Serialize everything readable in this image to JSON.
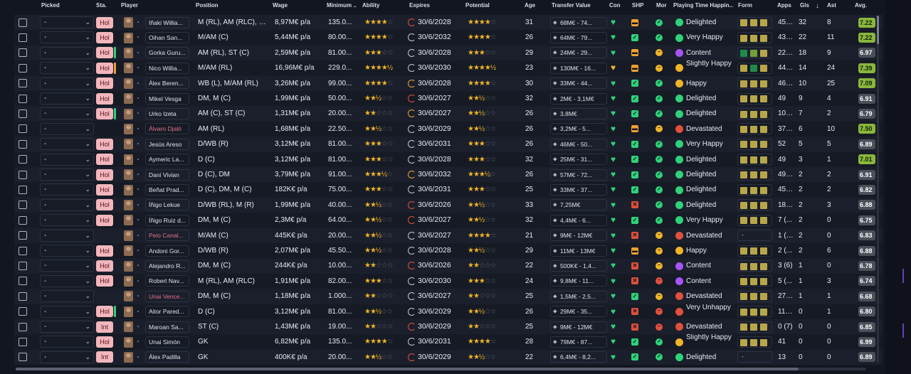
{
  "header": {
    "picked": "Picked",
    "sta": "Sta.",
    "player": "Player",
    "position": "Position",
    "wage": "Wage",
    "minimum": "Minimum ...",
    "ability": "Ability",
    "expires": "Expires",
    "potential": "Potential",
    "age": "Age",
    "transfer_value": "Transfer Value",
    "con": "Con",
    "shp": "SHP",
    "mor": "Mor",
    "playing_time": "Playing Time Happin...",
    "form": "Form",
    "apps": "Apps",
    "gls": "Gls",
    "sort_icon": "↓",
    "ast": "Ast",
    "avg": "Avg."
  },
  "colors": {
    "form_olive": "#b8a64a",
    "form_green": "#6fa03a",
    "form_dark_green": "#1f8a4a",
    "shp_orange": "#f0a030",
    "shp_green": "#2fd27a",
    "shp_red": "#e0503c",
    "hap_green": "#2fd27a",
    "hap_purple": "#a855f7",
    "hap_yellow": "#f0b429",
    "hap_red": "#e0503c",
    "con_green": "#2fd27a",
    "con_yellow": "#f0b429",
    "loan_name": "#e0748a",
    "rating_green": "#8ab63c"
  },
  "rows": [
    {
      "picked": "-",
      "sta": "Hol",
      "stabar": "none",
      "name": "Iñaki Willia...",
      "loan": false,
      "position": "M (RL), AM (RLC), S...",
      "wage": "8,97M€ p/a",
      "min": "135.0...",
      "ability": "★★★★",
      "ability_e": "☆",
      "expires": "30/6/2028",
      "exp": "red",
      "potential": "★★★★",
      "potential_e": "☆",
      "age": "31",
      "tv": "68M€ - 74...",
      "con": "💚",
      "shp": "orange",
      "mor": "green",
      "hap": "Delighted",
      "hapc": "green",
      "form": [
        "olive",
        "olive",
        "olive"
      ],
      "apps": "45 ...",
      "gls": "32",
      "ast": "8",
      "avg": "7.22",
      "avgc": "green"
    },
    {
      "picked": "-",
      "sta": "Hol",
      "stabar": "none",
      "name": "Oihan San...",
      "loan": false,
      "position": "M/AM (C)",
      "wage": "5,44M€ p/a",
      "min": "80.00...",
      "ability": "★★★★",
      "ability_e": "☆",
      "expires": "30/6/2032",
      "exp": "grey",
      "potential": "★★★★",
      "potential_e": "☆",
      "age": "26",
      "tv": "64M€ - 79...",
      "con": "💚",
      "shp": "green",
      "mor": "green",
      "hap": "Very Happy",
      "hapc": "green",
      "form": [
        "olive",
        "olive",
        "olive"
      ],
      "apps": "43 ...",
      "gls": "22",
      "ast": "11",
      "avg": "7.22",
      "avgc": "green"
    },
    {
      "picked": "-",
      "sta": "Hol",
      "stabar": "green",
      "name": "Gorka Guru...",
      "loan": false,
      "position": "AM (RL), ST (C)",
      "wage": "2,59M€ p/a",
      "min": "81.00...",
      "ability": "★★★",
      "ability_e": "☆☆",
      "expires": "30/6/2028",
      "exp": "grey",
      "potential": "★★★",
      "potential_e": "☆☆",
      "age": "29",
      "tv": "24M€ - 29...",
      "con": "💚",
      "shp": "orange",
      "mor": "yellow",
      "hap": "Content",
      "hapc": "purple",
      "form": [
        "dgreen",
        "green",
        "olive"
      ],
      "apps": "22 ...",
      "gls": "18",
      "ast": "9",
      "avg": "6.97",
      "avgc": "grey"
    },
    {
      "picked": "-",
      "sta": "Hol",
      "stabar": "orange",
      "name": "Nico Willia...",
      "loan": false,
      "position": "M/AM (RL)",
      "wage": "16,96M€ p/a",
      "min": "229.0...",
      "ability": "★★★★½",
      "ability_e": "",
      "expires": "30/6/2030",
      "exp": "grey",
      "potential": "★★★★½",
      "potential_e": "",
      "age": "23",
      "tv": "130M€ - 16...",
      "con": "💛",
      "shp": "orange",
      "mor": "yellow",
      "hap": "Slightly Happy",
      "hapc": "yellow",
      "form": [
        "olive",
        "dgreen",
        "olive"
      ],
      "apps": "44 ...",
      "gls": "14",
      "ast": "24",
      "avg": "7.39",
      "avgc": "green"
    },
    {
      "picked": "-",
      "sta": "Hol",
      "stabar": "none",
      "name": "Álex Beren...",
      "loan": false,
      "position": "WB (L), M/AM (RL)",
      "wage": "3,26M€ p/a",
      "min": "99.00...",
      "ability": "★★★★",
      "ability_e": "☆",
      "expires": "30/6/2028",
      "exp": "orange",
      "potential": "★★★★",
      "potential_e": "☆",
      "age": "30",
      "tv": "33M€ - 44...",
      "con": "💚",
      "shp": "green",
      "mor": "green",
      "hap": "Happy",
      "hapc": "yellow",
      "form": [
        "olive",
        "olive",
        "olive"
      ],
      "apps": "46 ...",
      "gls": "10",
      "ast": "25",
      "avg": "7.09",
      "avgc": "green"
    },
    {
      "picked": "-",
      "sta": "Hol",
      "stabar": "none",
      "name": "Mikel Vesga",
      "loan": false,
      "position": "DM, M (C)",
      "wage": "1,99M€ p/a",
      "min": "50.00...",
      "ability": "★★½",
      "ability_e": "☆☆",
      "expires": "30/6/2027",
      "exp": "red",
      "potential": "★★½",
      "potential_e": "☆☆",
      "age": "32",
      "tv": "2M€ - 3,1M€",
      "con": "💚",
      "shp": "green",
      "mor": "green",
      "hap": "Delighted",
      "hapc": "green",
      "form": [
        "olive",
        "olive",
        "olive"
      ],
      "apps": "49",
      "gls": "9",
      "ast": "4",
      "avg": "6.91",
      "avgc": "grey"
    },
    {
      "picked": "-",
      "sta": "Hol",
      "stabar": "green",
      "name": "Urko Izeta",
      "loan": false,
      "position": "AM (C), ST (C)",
      "wage": "1,31M€ p/a",
      "min": "20.00...",
      "ability": "★★",
      "ability_e": "☆☆☆",
      "expires": "30/6/2027",
      "exp": "orange",
      "potential": "★★½",
      "potential_e": "☆☆",
      "age": "26",
      "tv": "3,8M€",
      "con": "💚",
      "shp": "green",
      "mor": "green",
      "hap": "Delighted",
      "hapc": "green",
      "form": [
        "olive",
        "olive",
        "olive"
      ],
      "apps": "10 (...",
      "gls": "7",
      "ast": "2",
      "avg": "6.79",
      "avgc": "grey"
    },
    {
      "picked": "-",
      "sta": "",
      "stabar": "none",
      "name": "Álvaro Djaló",
      "loan": true,
      "position": "AM (RL)",
      "wage": "1,68M€ p/a",
      "min": "22.50...",
      "ability": "★★½",
      "ability_e": "☆☆",
      "expires": "30/6/2029",
      "exp": "grey",
      "potential": "★★½",
      "potential_e": "☆☆",
      "age": "26",
      "tv": "3,2M€ - 5...",
      "con": "💚",
      "shp": "orange",
      "mor": "yellow",
      "hap": "Devastated",
      "hapc": "red",
      "form": [
        "olive",
        "olive",
        "olive"
      ],
      "apps": "37 ...",
      "gls": "6",
      "ast": "10",
      "avg": "7.50",
      "avgc": "green"
    },
    {
      "picked": "-",
      "sta": "Hol",
      "stabar": "none",
      "name": "Jesús Areso",
      "loan": false,
      "position": "D/WB (R)",
      "wage": "3,12M€ p/a",
      "min": "81.00...",
      "ability": "★★★",
      "ability_e": "☆☆",
      "expires": "30/6/2031",
      "exp": "grey",
      "potential": "★★★",
      "potential_e": "☆☆",
      "age": "26",
      "tv": "46M€ - 50...",
      "con": "💚",
      "shp": "green",
      "mor": "green",
      "hap": "Very Happy",
      "hapc": "green",
      "form": [
        "olive",
        "olive",
        "olive"
      ],
      "apps": "52",
      "gls": "5",
      "ast": "5",
      "avg": "6.89",
      "avgc": "grey"
    },
    {
      "picked": "-",
      "sta": "Hol",
      "stabar": "none",
      "name": "Aymeric La...",
      "loan": false,
      "position": "D (C)",
      "wage": "3,12M€ p/a",
      "min": "81.00...",
      "ability": "★★★",
      "ability_e": "☆☆",
      "expires": "30/6/2028",
      "exp": "grey",
      "potential": "★★★",
      "potential_e": "☆☆",
      "age": "32",
      "tv": "25M€ - 31...",
      "con": "💚",
      "shp": "green",
      "mor": "green",
      "hap": "Delighted",
      "hapc": "green",
      "form": [
        "olive",
        "olive",
        "olive"
      ],
      "apps": "49",
      "gls": "3",
      "ast": "1",
      "avg": "7.01",
      "avgc": "green"
    },
    {
      "picked": "-",
      "sta": "Hol",
      "stabar": "none",
      "name": "Dani Vivian",
      "loan": false,
      "position": "D (C), DM",
      "wage": "3,79M€ p/a",
      "min": "91.00...",
      "ability": "★★★½",
      "ability_e": "☆",
      "expires": "30/6/2032",
      "exp": "orange",
      "potential": "★★★½",
      "potential_e": "☆",
      "age": "26",
      "tv": "57M€ - 72...",
      "con": "💚",
      "shp": "green",
      "mor": "green",
      "hap": "Delighted",
      "hapc": "green",
      "form": [
        "olive",
        "olive",
        "olive"
      ],
      "apps": "49 ...",
      "gls": "2",
      "ast": "2",
      "avg": "6.91",
      "avgc": "grey"
    },
    {
      "picked": "-",
      "sta": "Hol",
      "stabar": "none",
      "name": "Beñat Prad...",
      "loan": false,
      "position": "D (C), DM, M (C)",
      "wage": "182K€ p/a",
      "min": "75.00...",
      "ability": "★★★",
      "ability_e": "☆☆",
      "expires": "30/6/2031",
      "exp": "grey",
      "potential": "★★★",
      "potential_e": "☆☆",
      "age": "25",
      "tv": "33M€ - 37...",
      "con": "💚",
      "shp": "green",
      "mor": "green",
      "hap": "Delighted",
      "hapc": "green",
      "form": [
        "olive",
        "olive",
        "olive"
      ],
      "apps": "45 ...",
      "gls": "2",
      "ast": "2",
      "avg": "6.82",
      "avgc": "grey"
    },
    {
      "picked": "-",
      "sta": "Hol",
      "stabar": "none",
      "name": "Íñigo Lekue",
      "loan": false,
      "position": "D/WB (RL), M (R)",
      "wage": "1,99M€ p/a",
      "min": "40.00...",
      "ability": "★★½",
      "ability_e": "☆☆",
      "expires": "30/6/2026",
      "exp": "red",
      "potential": "★★½",
      "potential_e": "☆☆",
      "age": "33",
      "tv": "7,25M€",
      "con": "💚",
      "shp": "red",
      "mor": "green",
      "hap": "Delighted",
      "hapc": "green",
      "form": [
        "olive",
        "olive",
        "olive"
      ],
      "apps": "18 ...",
      "gls": "2",
      "ast": "3",
      "avg": "6.88",
      "avgc": "grey"
    },
    {
      "picked": "-",
      "sta": "Hol",
      "stabar": "none",
      "name": "Íñigo Ruiz d...",
      "loan": false,
      "position": "DM, M (C)",
      "wage": "2,3M€ p/a",
      "min": "64.00...",
      "ability": "★★½",
      "ability_e": "☆☆",
      "expires": "30/6/2027",
      "exp": "red",
      "potential": "★★½",
      "potential_e": "☆☆",
      "age": "32",
      "tv": "4,4M€ - 6...",
      "con": "💚",
      "shp": "green",
      "mor": "green",
      "hap": "Very Happy",
      "hapc": "green",
      "form": [
        "olive",
        "olive",
        "olive"
      ],
      "apps": "7 (...",
      "gls": "2",
      "ast": "0",
      "avg": "6.75",
      "avgc": "grey"
    },
    {
      "picked": "-",
      "sta": "",
      "stabar": "none",
      "name": "Peio Canal...",
      "loan": true,
      "position": "M/AM (C)",
      "wage": "445K€ p/a",
      "min": "20.00...",
      "ability": "★★½",
      "ability_e": "☆☆",
      "expires": "30/6/2027",
      "exp": "grey",
      "potential": "★★★★",
      "potential_e": "☆",
      "age": "21",
      "tv": "9M€ - 12M€",
      "con": "💚",
      "shp": "red",
      "mor": "yellow",
      "hap": "Devastated",
      "hapc": "red",
      "form": [],
      "apps": "1 (17)",
      "gls": "2",
      "ast": "0",
      "avg": "6.83",
      "avgc": "grey"
    },
    {
      "picked": "-",
      "sta": "Hol",
      "stabar": "none",
      "name": "Andoni Gor...",
      "loan": false,
      "position": "D/WB (R)",
      "wage": "2,07M€ p/a",
      "min": "45.50...",
      "ability": "★★½",
      "ability_e": "☆☆",
      "expires": "30/6/2028",
      "exp": "grey",
      "potential": "★★½",
      "potential_e": "☆☆",
      "age": "29",
      "tv": "11M€ - 13M€",
      "con": "💚",
      "shp": "orange",
      "mor": "yellow",
      "hap": "Happy",
      "hapc": "yellow",
      "form": [
        "olive",
        "olive",
        "olive"
      ],
      "apps": "2 (...",
      "gls": "2",
      "ast": "6",
      "avg": "6.88",
      "avgc": "grey"
    },
    {
      "picked": "-",
      "sta": "Hol",
      "stabar": "none",
      "name": "Alejandro R...",
      "loan": false,
      "position": "DM, M (C)",
      "wage": "244K€ p/a",
      "min": "10.00...",
      "ability": "★★",
      "ability_e": "☆☆☆",
      "expires": "30/6/2026",
      "exp": "red",
      "potential": "★★",
      "potential_e": "☆☆☆",
      "age": "22",
      "tv": "500K€ - 1,4...",
      "con": "💚",
      "shp": "red",
      "mor": "yellow",
      "hap": "Content",
      "hapc": "purple",
      "form": [
        "olive",
        "olive",
        "olive"
      ],
      "apps": "3 (6)",
      "gls": "1",
      "ast": "0",
      "avg": "6.78",
      "avgc": "grey"
    },
    {
      "picked": "-",
      "sta": "Hol",
      "stabar": "none",
      "name": "Robert Nav...",
      "loan": false,
      "position": "M (RL), AM (RLC)",
      "wage": "1,91M€ p/a",
      "min": "82.00...",
      "ability": "★★★",
      "ability_e": "☆☆",
      "expires": "30/6/2030",
      "exp": "grey",
      "potential": "★★★",
      "potential_e": "☆☆",
      "age": "24",
      "tv": "9,8M€ - 11...",
      "con": "💚",
      "shp": "red",
      "mor": "red",
      "hap": "Content",
      "hapc": "purple",
      "form": [
        "olive",
        "olive",
        "olive"
      ],
      "apps": "5 (...",
      "gls": "1",
      "ast": "3",
      "avg": "6.74",
      "avgc": "grey"
    },
    {
      "picked": "-",
      "sta": "",
      "stabar": "none",
      "name": "Unai Vence...",
      "loan": true,
      "position": "DM, M (C)",
      "wage": "1,18M€ p/a",
      "min": "1.000...",
      "ability": "★★",
      "ability_e": "☆☆☆",
      "expires": "30/6/2027",
      "exp": "grey",
      "potential": "★★",
      "potential_e": "☆☆☆",
      "age": "25",
      "tv": "1,5M€ - 2,5...",
      "con": "💚",
      "shp": "green",
      "mor": "yellow",
      "hap": "Devastated",
      "hapc": "red",
      "form": [
        "olive",
        "olive",
        "olive"
      ],
      "apps": "27 ...",
      "gls": "1",
      "ast": "1",
      "avg": "6.68",
      "avgc": "grey"
    },
    {
      "picked": "-",
      "sta": "Hol",
      "stabar": "green",
      "name": "Aitor Pared...",
      "loan": false,
      "position": "D (C)",
      "wage": "3,12M€ p/a",
      "min": "81.00...",
      "ability": "★★½",
      "ability_e": "☆☆",
      "expires": "30/6/2029",
      "exp": "grey",
      "potential": "★★½",
      "potential_e": "☆☆",
      "age": "26",
      "tv": "29M€ - 35...",
      "con": "💚",
      "shp": "red",
      "mor": "red",
      "hap": "Very Unhappy",
      "hapc": "red",
      "form": [
        "olive",
        "olive",
        "olive"
      ],
      "apps": "11 (...",
      "gls": "0",
      "ast": "1",
      "avg": "6.80",
      "avgc": "grey"
    },
    {
      "picked": "-",
      "sta": "Int",
      "stabar": "none",
      "name": "Maroan Sa...",
      "loan": false,
      "position": "ST (C)",
      "wage": "1,43M€ p/a",
      "min": "19.00...",
      "ability": "★★",
      "ability_e": "☆☆☆",
      "expires": "30/6/2029",
      "exp": "red",
      "potential": "★★",
      "potential_e": "☆☆☆",
      "age": "25",
      "tv": "9M€ - 12M€",
      "con": "💚",
      "shp": "red",
      "mor": "red",
      "hap": "Devastated",
      "hapc": "red",
      "form": [
        "olive",
        "olive",
        "olive"
      ],
      "apps": "0 (7)",
      "gls": "0",
      "ast": "0",
      "avg": "6.85",
      "avgc": "grey"
    },
    {
      "picked": "-",
      "sta": "Hol",
      "stabar": "none",
      "name": "Unai Simón",
      "loan": false,
      "position": "GK",
      "wage": "6,82M€ p/a",
      "min": "135.0...",
      "ability": "★★★★",
      "ability_e": "☆",
      "expires": "30/6/2031",
      "exp": "grey",
      "potential": "★★★★",
      "potential_e": "☆",
      "age": "28",
      "tv": "79M€ - 87...",
      "con": "💚",
      "shp": "green",
      "mor": "green",
      "hap": "Slightly Happy",
      "hapc": "yellow",
      "form": [
        "olive",
        "olive",
        "olive"
      ],
      "apps": "41",
      "gls": "0",
      "ast": "0",
      "avg": "6.99",
      "avgc": "grey"
    },
    {
      "picked": "-",
      "sta": "Int",
      "stabar": "none",
      "name": "Álex Padilla",
      "loan": false,
      "position": "GK",
      "wage": "400K€ p/a",
      "min": "20.00...",
      "ability": "★★½",
      "ability_e": "☆☆",
      "expires": "30/6/2029",
      "exp": "red",
      "potential": "★★½",
      "potential_e": "☆☆",
      "age": "22",
      "tv": "6,4M€ - 8,2...",
      "con": "💚",
      "shp": "green",
      "mor": "green",
      "hap": "Delighted",
      "hapc": "green",
      "form": [],
      "apps": "13",
      "gls": "0",
      "ast": "0",
      "avg": "6.89",
      "avgc": "grey"
    }
  ]
}
